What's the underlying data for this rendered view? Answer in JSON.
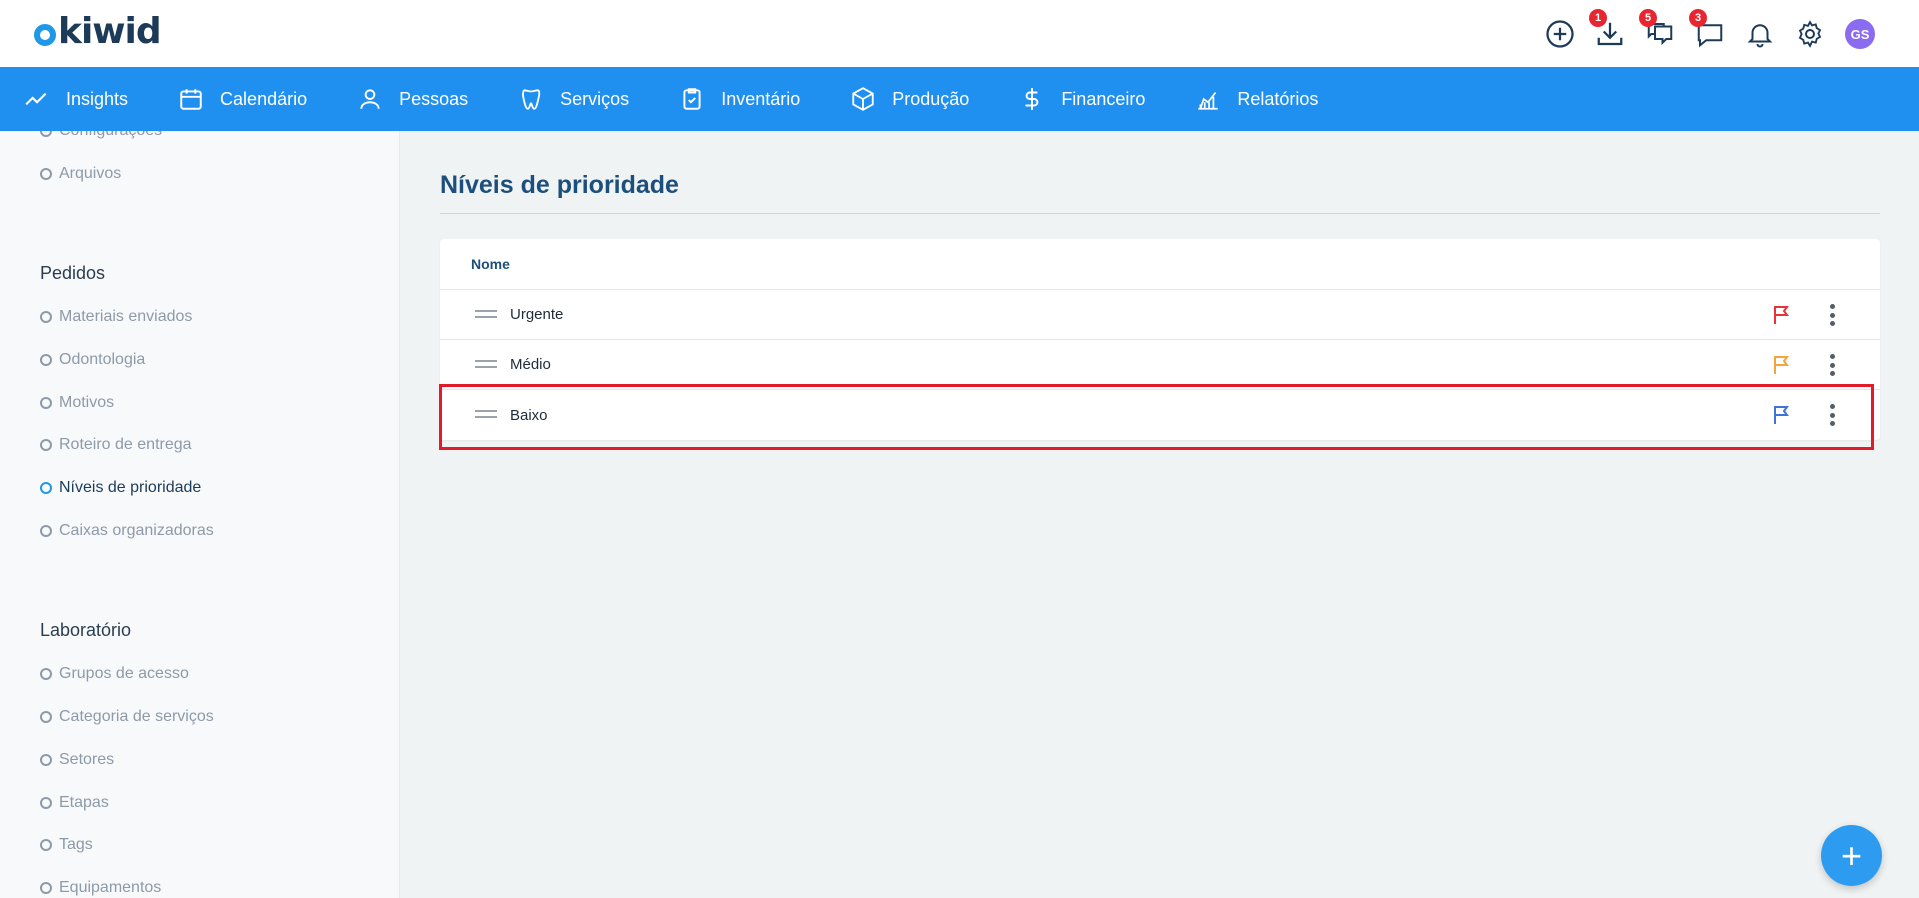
{
  "header": {
    "logo_text": "kiwid",
    "badges": {
      "downloads": "1",
      "chats": "5",
      "messages": "3"
    },
    "avatar_initials": "GS",
    "icons": [
      "add-circle-icon",
      "download-icon",
      "chats-icon",
      "message-icon",
      "bell-icon",
      "gear-icon"
    ]
  },
  "nav": {
    "items": [
      {
        "label": "Insights",
        "icon": "trend-icon"
      },
      {
        "label": "Calendário",
        "icon": "calendar-icon"
      },
      {
        "label": "Pessoas",
        "icon": "person-icon"
      },
      {
        "label": "Serviços",
        "icon": "tooth-icon"
      },
      {
        "label": "Inventário",
        "icon": "clipboard-check-icon"
      },
      {
        "label": "Produção",
        "icon": "box-icon"
      },
      {
        "label": "Financeiro",
        "icon": "dollar-icon"
      },
      {
        "label": "Relatórios",
        "icon": "chart-icon"
      }
    ]
  },
  "sidebar": {
    "top_items": [
      "Configurações",
      "Arquivos"
    ],
    "pedidos": {
      "title": "Pedidos",
      "items": [
        "Materiais enviados",
        "Odontologia",
        "Motivos",
        "Roteiro de entrega",
        "Níveis de prioridade",
        "Caixas organizadoras"
      ],
      "active": "Níveis de prioridade"
    },
    "laboratorio": {
      "title": "Laboratório",
      "items": [
        "Grupos de acesso",
        "Categoria de serviços",
        "Setores",
        "Etapas",
        "Tags",
        "Equipamentos"
      ]
    }
  },
  "main": {
    "title": "Níveis de prioridade",
    "table": {
      "header": "Nome",
      "rows": [
        {
          "name": "Urgente",
          "flag_color": "#ea3338"
        },
        {
          "name": "Médio",
          "flag_color": "#f3a43b"
        },
        {
          "name": "Baixo",
          "flag_color": "#3f73d8"
        }
      ]
    },
    "fab_label": "+"
  },
  "colors": {
    "primary": "#1f8ff0",
    "highlight": "#e21b2b"
  }
}
